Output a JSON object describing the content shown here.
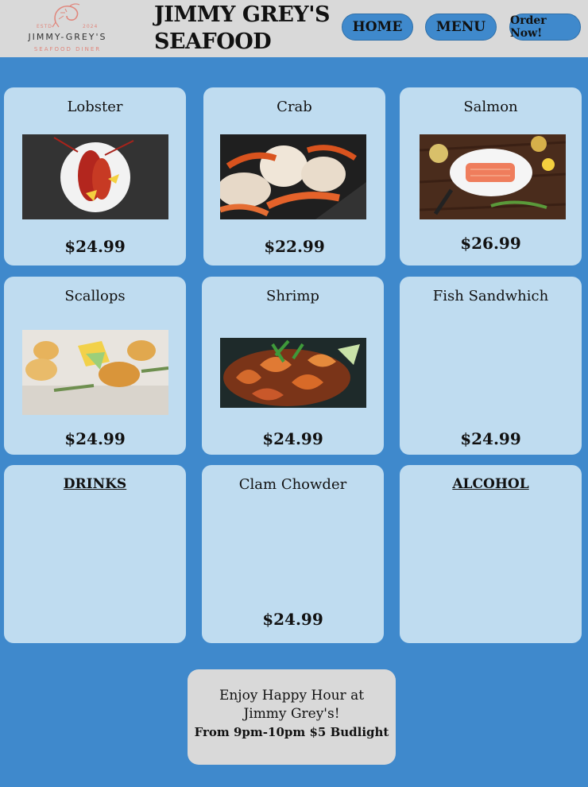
{
  "header": {
    "logo": {
      "estd": "ESTD",
      "year": "2024",
      "name": "JIMMY-GREY'S",
      "tagline": "SEAFOOD DINER",
      "icon": "shrimp-icon"
    },
    "title": "JIMMY GREY'S SEAFOOD",
    "nav": {
      "home": "HOME",
      "menu": "MENU",
      "order": "Order Now!"
    }
  },
  "menu": {
    "lobster": {
      "name": "Lobster",
      "price": "$24.99",
      "image": "lobster-photo"
    },
    "crab": {
      "name": "Crab",
      "price": "$22.99",
      "image": "crab-photo"
    },
    "salmon": {
      "name": "Salmon",
      "price": "$26.99",
      "image": "salmon-photo"
    },
    "scallops": {
      "name": "Scallops",
      "price": "$24.99",
      "image": "scallops-photo"
    },
    "shrimp": {
      "name": "Shrimp",
      "price": "$24.99",
      "image": "shrimp-photo"
    },
    "fish_sandwich": {
      "name": "Fish Sandwhich",
      "price": "$24.99"
    },
    "drinks": {
      "name": "DRINKS"
    },
    "clam_chowder": {
      "name": "Clam Chowder",
      "price": "$24.99"
    },
    "alcohol": {
      "name": "ALCOHOL"
    }
  },
  "promo": {
    "line1": "Enjoy Happy Hour at Jimmy Grey's!",
    "line2": "From 9pm-10pm $5 Budlight"
  },
  "colors": {
    "background": "#3f89cc",
    "header": "#d9d9d9",
    "card": "#bfdcf0",
    "accent": "#e0867c"
  }
}
